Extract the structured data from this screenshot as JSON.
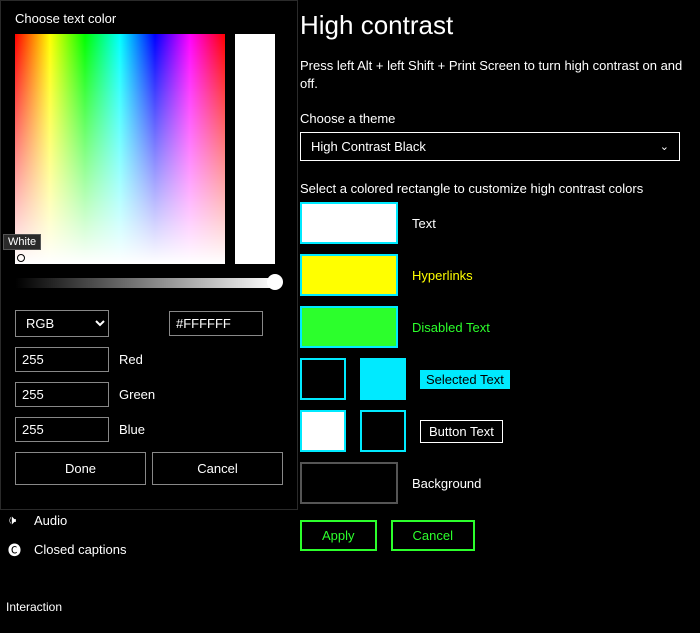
{
  "page": {
    "title": "High contrast",
    "description": "Press left Alt + left Shift + Print Screen to turn high contrast on and off.",
    "choose_theme_label": "Choose a theme",
    "theme": "High Contrast Black",
    "select_instruction": "Select a colored rectangle to customize high contrast colors",
    "swatches": {
      "text": {
        "label": "Text",
        "color": "#ffffff",
        "labelColor": "#ffffff"
      },
      "hyperlinks": {
        "label": "Hyperlinks",
        "color": "#ffff00",
        "labelColor": "#ffff00"
      },
      "disabled": {
        "label": "Disabled Text",
        "color": "#2cff2c",
        "labelColor": "#2cff2c"
      },
      "selected": {
        "label": "Selected Text",
        "left": "#000000",
        "right": "#00eaff",
        "labelBg": "#00eaff",
        "labelColor": "#000000"
      },
      "button": {
        "label": "Button Text",
        "left": "#ffffff",
        "right": "#000000",
        "border": "#ffffff"
      },
      "background": {
        "label": "Background",
        "color": "#000000"
      }
    },
    "apply": "Apply",
    "cancel": "Cancel"
  },
  "sidebar": {
    "audio": "Audio",
    "closed_captions": "Closed captions",
    "interaction": "Interaction"
  },
  "picker": {
    "title": "Choose text color",
    "tooltip": "White",
    "mode": "RGB",
    "hex": "#FFFFFF",
    "r": "255",
    "g": "255",
    "b": "255",
    "red_label": "Red",
    "green_label": "Green",
    "blue_label": "Blue",
    "done": "Done",
    "cancel": "Cancel"
  }
}
